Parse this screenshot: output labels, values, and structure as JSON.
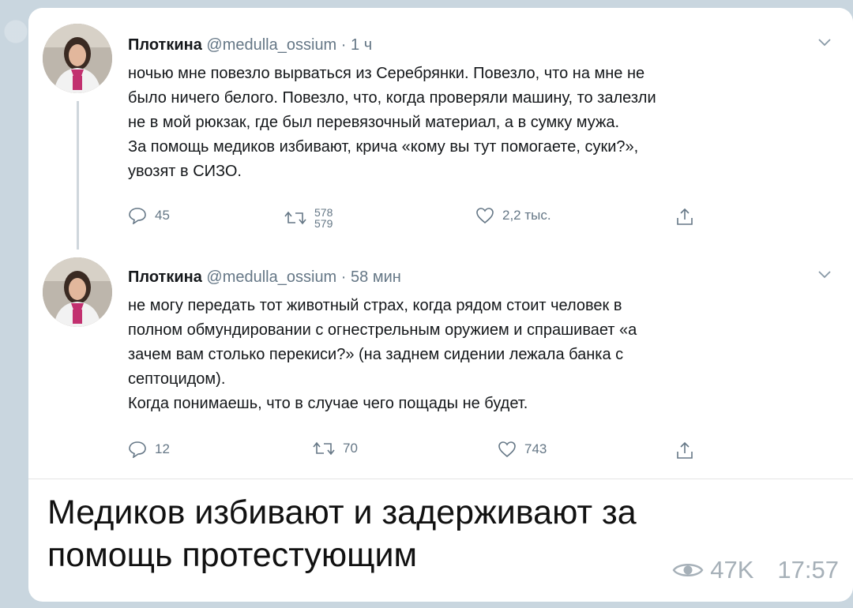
{
  "tweets": [
    {
      "author_name": "Плоткина",
      "handle": "@medulla_ossium",
      "separator": "·",
      "time": "1 ч",
      "lines": [
        "ночью мне повезло вырваться из Серебрянки. Повезло, что на мне не",
        "было ничего белого. Повезло, что, когда проверяли машину, то залезли",
        "не в мой рюкзак, где был перевязочный материал, а в сумку мужа.",
        "За помощь медиков избивают, крича «кому вы тут помогаете, суки?»,",
        "увозят в СИЗО."
      ],
      "replies": "45",
      "retweets_old": "578",
      "retweets_new": "579",
      "likes": "2,2 тыс."
    },
    {
      "author_name": "Плоткина",
      "handle": "@medulla_ossium",
      "separator": "·",
      "time": "58 мин",
      "lines": [
        "не могу передать тот животный страх, когда рядом стоит человек в",
        "полном обмундировании с огнестрельным оружием и спрашивает «а",
        "зачем вам столько перекиси?» (на заднем сидении лежала банка с",
        "септоцидом).",
        "Когда понимаешь, что в случае чего пощады не будет."
      ],
      "replies": "12",
      "retweets": "70",
      "likes": "743"
    }
  ],
  "message": {
    "caption_line1": "Медиков избивают и задерживают за",
    "caption_line2": "помощь протестующим",
    "views": "47K",
    "time": "17:57"
  },
  "icons": {
    "reply": "reply-icon",
    "retweet": "retweet-icon",
    "like": "heart-icon",
    "share": "share-icon",
    "menu": "chevron-down-icon",
    "views": "eye-icon"
  },
  "colors": {
    "chat_background": "#c9d6df",
    "bubble": "#ffffff",
    "text": "#14171a",
    "muted": "#657786",
    "meta": "#a6b0b8"
  }
}
